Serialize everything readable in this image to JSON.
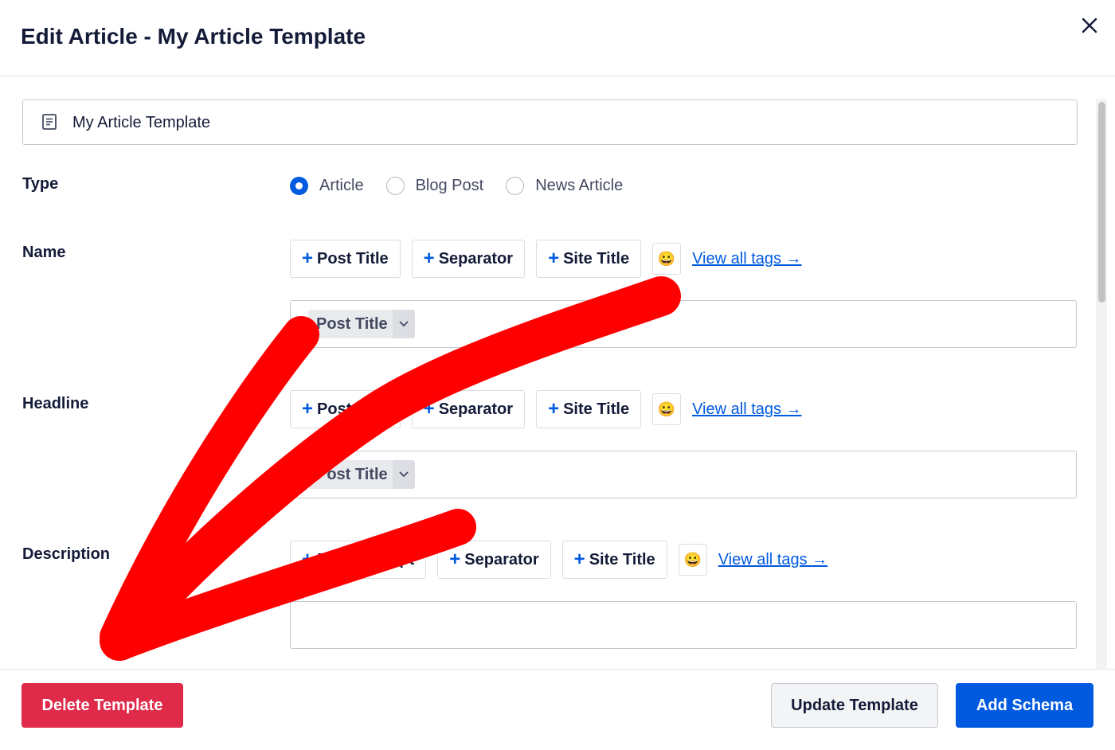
{
  "header": {
    "title": "Edit Article - My Article Template"
  },
  "template_name": {
    "value": "My Article Template"
  },
  "type": {
    "label": "Type",
    "options": [
      {
        "label": "Article",
        "selected": true
      },
      {
        "label": "Blog Post",
        "selected": false
      },
      {
        "label": "News Article",
        "selected": false
      }
    ]
  },
  "fields": [
    {
      "label": "Name",
      "tags": [
        "Post Title",
        "Separator",
        "Site Title"
      ],
      "view_all": "View all tags →",
      "chip": "Post Title"
    },
    {
      "label": "Headline",
      "tags": [
        "Post Title",
        "Separator",
        "Site Title"
      ],
      "view_all": "View all tags →",
      "chip": "Post Title"
    },
    {
      "label": "Description",
      "tags": [
        "Post Excerpt",
        "Separator",
        "Site Title"
      ],
      "view_all": "View all tags →",
      "chip": ""
    }
  ],
  "footer": {
    "delete_label": "Delete Template",
    "update_label": "Update Template",
    "add_label": "Add Schema"
  },
  "colors": {
    "accent": "#005ae0",
    "danger": "#df2a4a",
    "annotation": "#ff0000"
  },
  "icons": {
    "emoji": "😀",
    "plus": "+"
  }
}
